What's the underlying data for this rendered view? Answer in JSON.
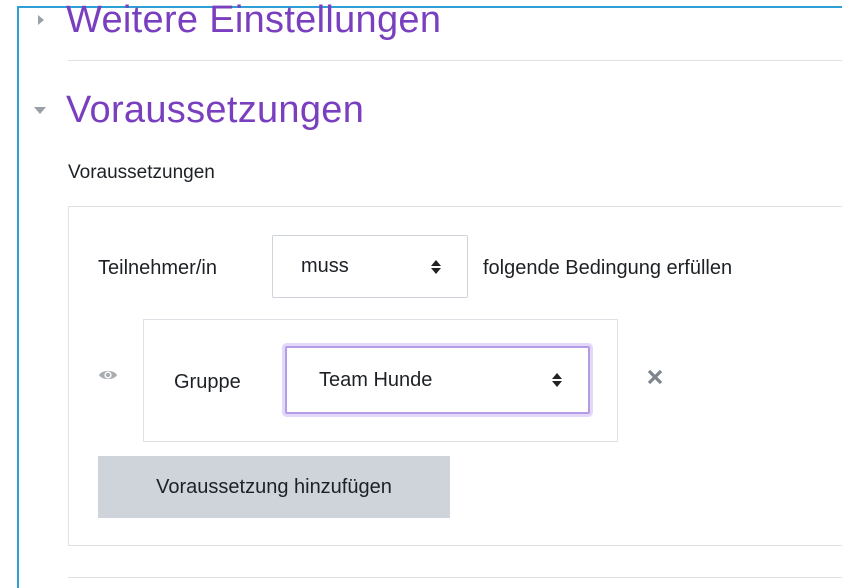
{
  "sections": {
    "weitere": {
      "title": "Weitere Einstellungen"
    },
    "voraussetzungen": {
      "title": "Voraussetzungen",
      "field_label": "Voraussetzungen"
    }
  },
  "restriction": {
    "prefix": "Teilnehmer/in",
    "mode_select": {
      "value": "muss"
    },
    "suffix": "folgende Bedingung erfüllen",
    "condition": {
      "eye_icon": "eye-icon",
      "label": "Gruppe",
      "group_select": {
        "value": "Team Hunde"
      },
      "delete_icon": "close-icon"
    },
    "add_button_label": "Voraussetzung hinzufügen"
  },
  "colors": {
    "section_title": "#7a3fbf",
    "frame_border": "#2fa0d6",
    "focus_border": "#b59ce6",
    "button_bg": "#ced4da"
  }
}
